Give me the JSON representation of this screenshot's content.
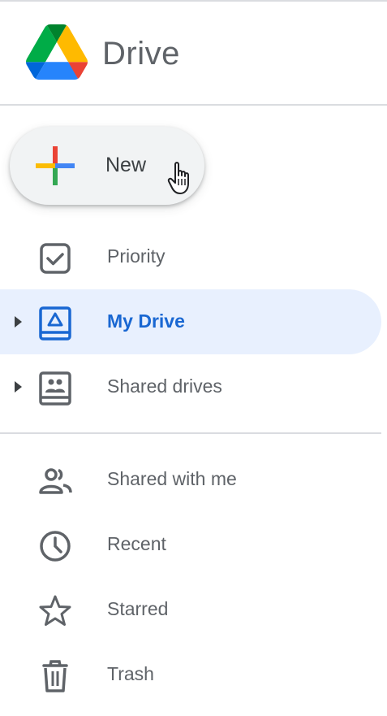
{
  "app": {
    "title": "Drive"
  },
  "new_button": {
    "label": "New"
  },
  "nav_primary": [
    {
      "label": "Priority",
      "icon": "priority-icon"
    },
    {
      "label": "My Drive",
      "icon": "my-drive-icon",
      "active": true
    },
    {
      "label": "Shared drives",
      "icon": "shared-drives-icon"
    }
  ],
  "nav_secondary": [
    {
      "label": "Shared with me",
      "icon": "people-icon"
    },
    {
      "label": "Recent",
      "icon": "clock-icon"
    },
    {
      "label": "Starred",
      "icon": "star-icon"
    },
    {
      "label": "Trash",
      "icon": "trash-icon"
    }
  ],
  "colors": {
    "active_bg": "#e8f0fe",
    "active_text": "#1967d2",
    "icon_gray": "#5f6368",
    "google_blue": "#4285f4",
    "google_red": "#ea4335",
    "google_yellow": "#fbbc04",
    "google_green": "#34a853"
  }
}
